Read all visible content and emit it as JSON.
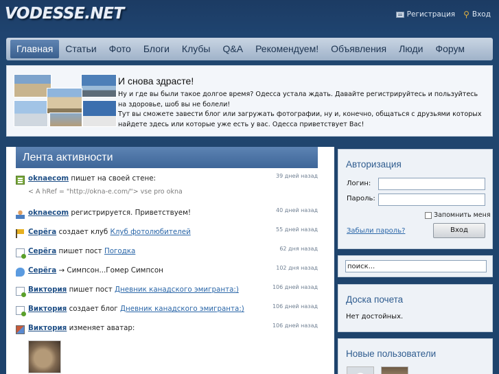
{
  "site": {
    "logo": "VODESSE.NET"
  },
  "header": {
    "register_label": "Регистрация",
    "login_label": "Вход"
  },
  "nav": {
    "tabs": [
      {
        "label": "Главная",
        "active": true
      },
      {
        "label": "Статьи"
      },
      {
        "label": "Фото"
      },
      {
        "label": "Блоги"
      },
      {
        "label": "Клубы"
      },
      {
        "label": "Q&A"
      },
      {
        "label": "Рекомендуем!"
      },
      {
        "label": "Объявления"
      },
      {
        "label": "Люди"
      },
      {
        "label": "Форум"
      }
    ]
  },
  "welcome": {
    "title": "И снова здрасте!",
    "line1": "Ну и где вы были такое долгое время? Одесса устала ждать. Давайте регистрируйтесь и пользуйтесь на здоровье, шоб вы не болели!",
    "line2": "Тут вы сможете завести блог или загружать фотографии, ну и, конечно, общаться с друзьями которых найдете здесь или которые уже есть у вас. Одесса приветствует Вас!"
  },
  "feed": {
    "title": "Лента активности",
    "items": [
      {
        "icon": "note-icon",
        "user": "oknaecom",
        "action": "пишет на своей стене:",
        "link": "",
        "when": "39 дней назад",
        "sub": "< A hRef = \"http://okna-e.com/\"> vse pro okna"
      },
      {
        "icon": "user-add-icon",
        "user": "oknaecom",
        "action": "регистрируется. Приветствуем!",
        "link": "",
        "when": "40 дней назад"
      },
      {
        "icon": "flag-icon",
        "user": "Серёга",
        "action": "создает клуб",
        "link": "Клуб фотолюбителей",
        "when": "55 дней назад"
      },
      {
        "icon": "doc-add-icon",
        "user": "Серёга",
        "action": "пишет пост",
        "link": "Погодка",
        "when": "62 дня назад"
      },
      {
        "icon": "chat-icon",
        "user": "Серёга",
        "action": "→ Симпсон...Гомер Симпсон",
        "link": "",
        "when": "102 дня назад"
      },
      {
        "icon": "doc-add-icon",
        "user": "Виктория",
        "action": "пишет пост",
        "link": "Дневник канадского эмигранта:)",
        "when": "106 дней назад"
      },
      {
        "icon": "doc-add-icon",
        "user": "Виктория",
        "action": "создает блог",
        "link": "Дневник канадского эмигранта:)",
        "when": "106 дней назад"
      },
      {
        "icon": "avatar-change-icon",
        "user": "Виктория",
        "action": "изменяет аватар:",
        "link": "",
        "when": "106 дней назад"
      }
    ]
  },
  "auth": {
    "title": "Авторизация",
    "login_label": "Логин:",
    "password_label": "Пароль:",
    "remember_label": "Запомнить меня",
    "forgot_label": "Забыли пароль?",
    "submit_label": "Вход"
  },
  "search": {
    "value": "поиск..."
  },
  "honor": {
    "title": "Доска почета",
    "text": "Нет достойных."
  },
  "new_users": {
    "title": "Новые пользователи"
  }
}
